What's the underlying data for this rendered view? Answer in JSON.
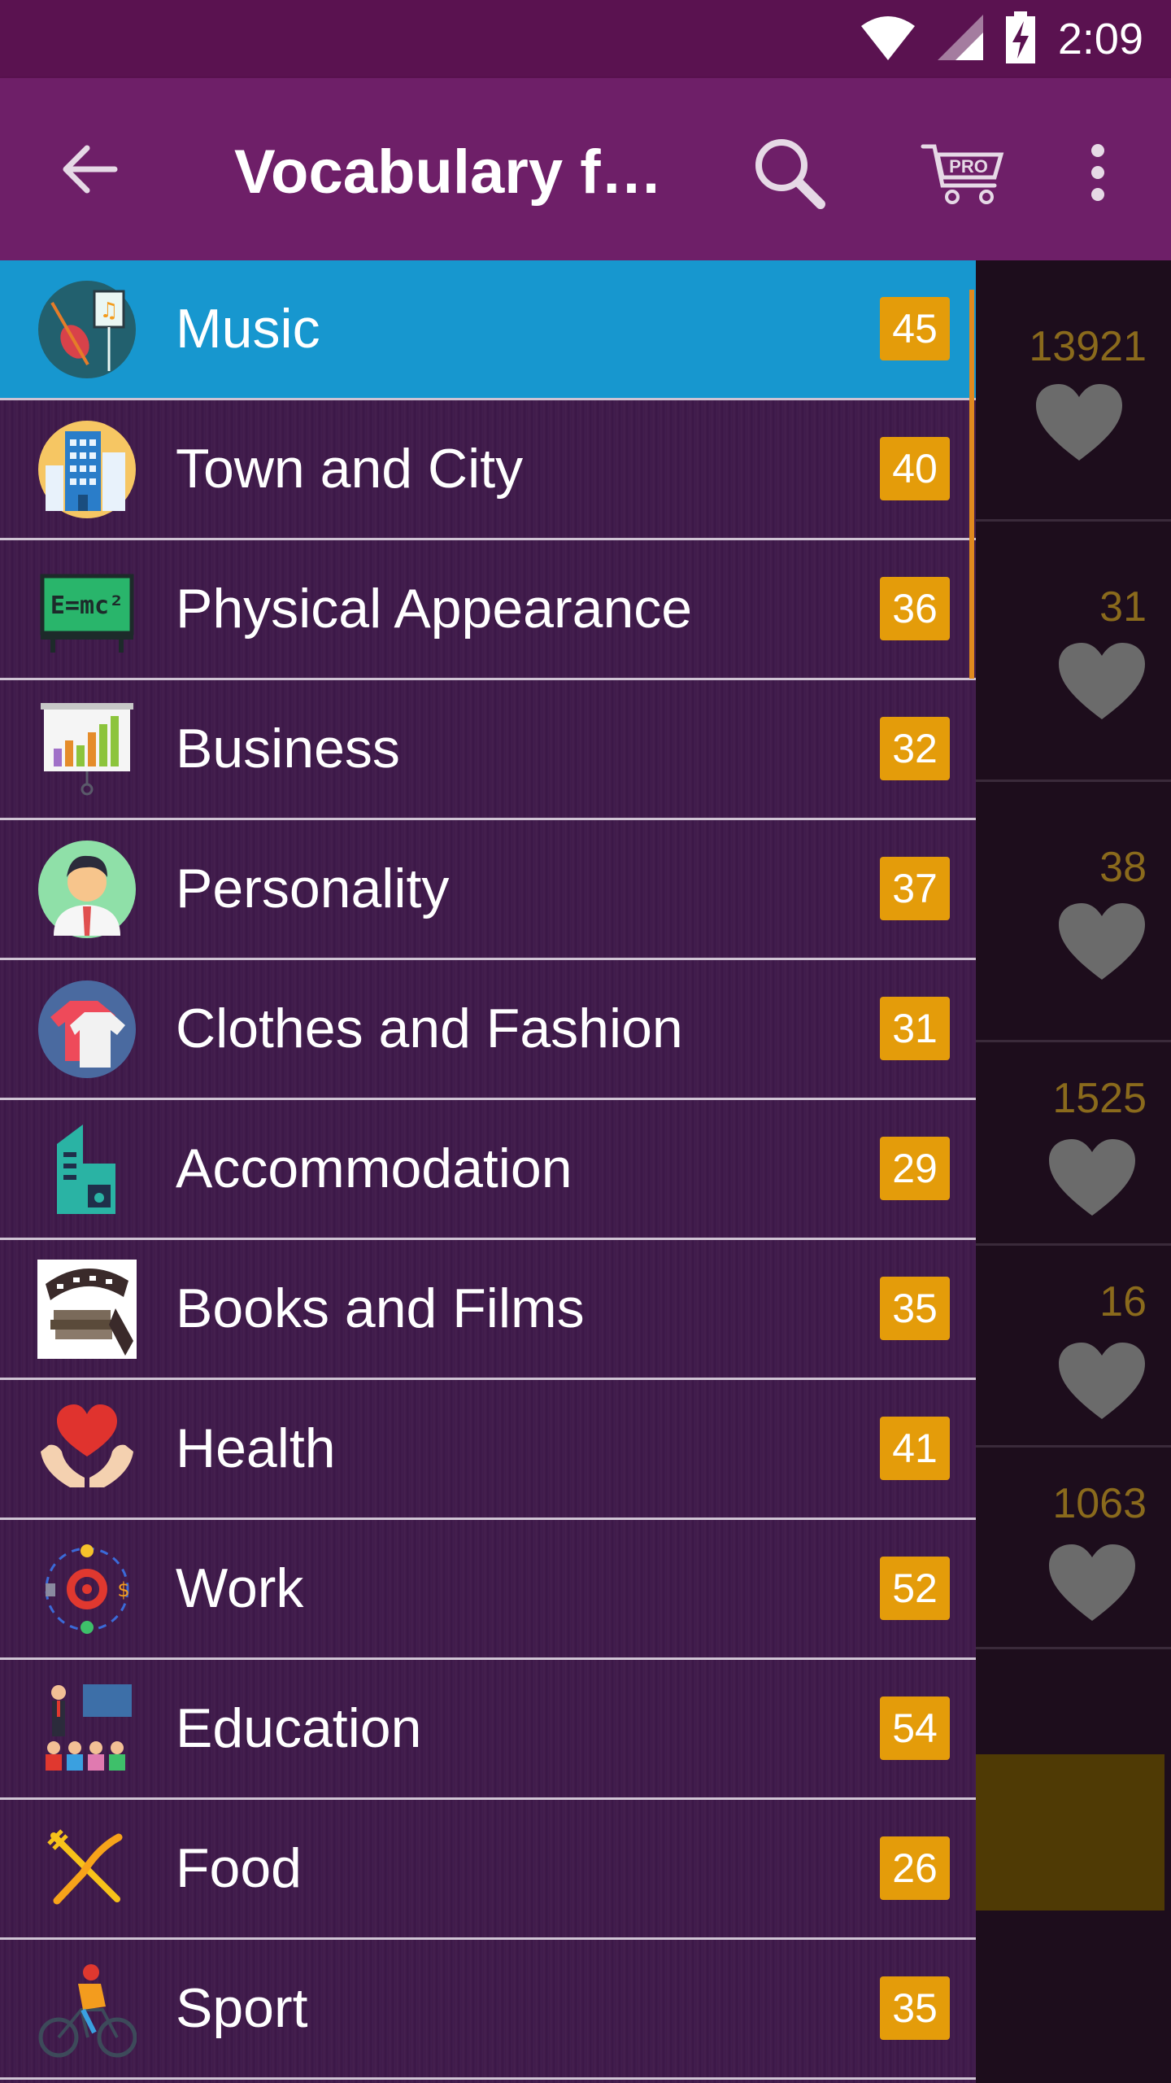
{
  "status": {
    "time": "2:09"
  },
  "appbar": {
    "title": "Vocabulary f…"
  },
  "colors": {
    "appbar": "#6e1f68",
    "statusbar": "#5a1250",
    "active_row": "#1797cf",
    "badge": "#e49c0a"
  },
  "categories": [
    {
      "label": "Music",
      "count": "45",
      "icon": "music-icon",
      "active": true
    },
    {
      "label": "Town and City",
      "count": "40",
      "icon": "city-buildings-icon"
    },
    {
      "label": "Physical Appearance",
      "count": "36",
      "icon": "blackboard-emc2-icon"
    },
    {
      "label": "Business",
      "count": "32",
      "icon": "bar-chart-board-icon"
    },
    {
      "label": "Personality",
      "count": "37",
      "icon": "person-avatar-icon"
    },
    {
      "label": "Clothes and Fashion",
      "count": "31",
      "icon": "clothes-icon"
    },
    {
      "label": "Accommodation",
      "count": "29",
      "icon": "building-icon"
    },
    {
      "label": "Books and Films",
      "count": "35",
      "icon": "film-reel-books-icon"
    },
    {
      "label": "Health",
      "count": "41",
      "icon": "heart-hands-icon"
    },
    {
      "label": "Work",
      "count": "52",
      "icon": "gear-work-icon"
    },
    {
      "label": "Education",
      "count": "54",
      "icon": "classroom-icon"
    },
    {
      "label": "Food",
      "count": "26",
      "icon": "fork-knife-icon"
    },
    {
      "label": "Sport",
      "count": "35",
      "icon": "cyclist-icon"
    }
  ],
  "background_cards": [
    {
      "number": "13921"
    },
    {
      "number": "31"
    },
    {
      "number": "38"
    },
    {
      "number": "1525"
    },
    {
      "number": "16"
    },
    {
      "number": "1063"
    }
  ]
}
